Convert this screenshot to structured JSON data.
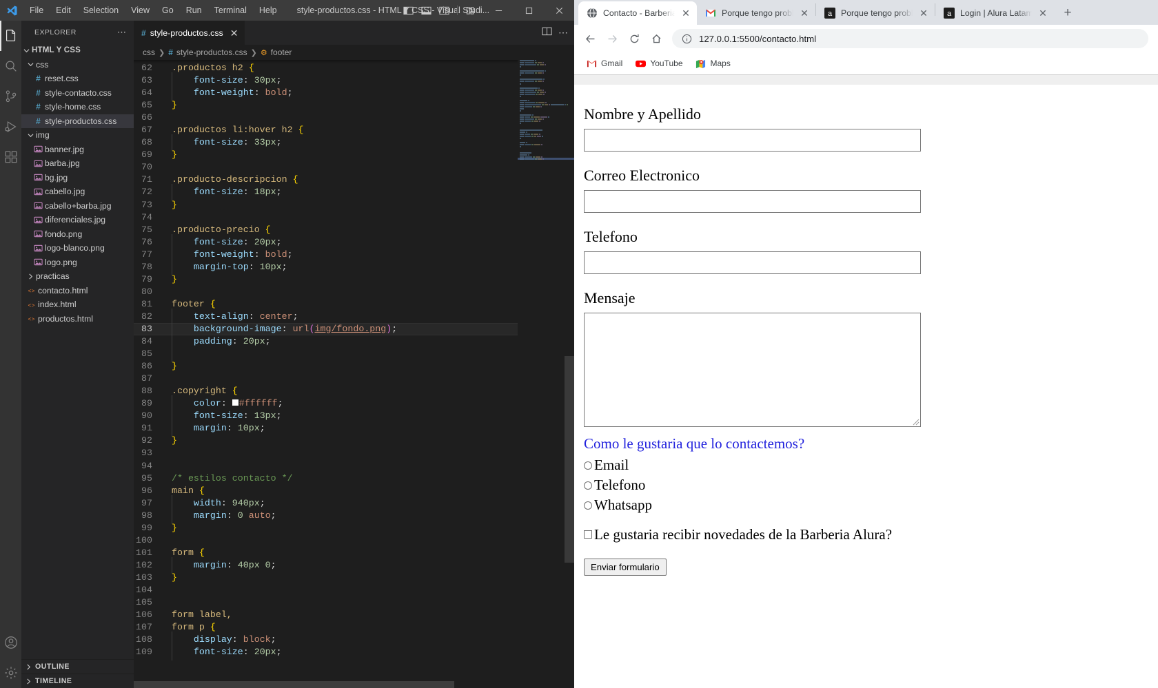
{
  "vscode": {
    "window_title": "style-productos.css - HTML Y CSS - Visual Studi...",
    "menu": [
      "File",
      "Edit",
      "Selection",
      "View",
      "Go",
      "Run",
      "Terminal",
      "Help"
    ],
    "sidebar": {
      "header": "EXPLORER",
      "root": "HTML Y CSS",
      "tree": [
        {
          "label": "css",
          "kind": "folder",
          "depth": 1,
          "expanded": true
        },
        {
          "label": "reset.css",
          "kind": "css",
          "depth": 2
        },
        {
          "label": "style-contacto.css",
          "kind": "css",
          "depth": 2
        },
        {
          "label": "style-home.css",
          "kind": "css",
          "depth": 2
        },
        {
          "label": "style-productos.css",
          "kind": "css",
          "depth": 2,
          "selected": true
        },
        {
          "label": "img",
          "kind": "folder",
          "depth": 1,
          "expanded": true
        },
        {
          "label": "banner.jpg",
          "kind": "image",
          "depth": 2
        },
        {
          "label": "barba.jpg",
          "kind": "image",
          "depth": 2
        },
        {
          "label": "bg.jpg",
          "kind": "image",
          "depth": 2
        },
        {
          "label": "cabello.jpg",
          "kind": "image",
          "depth": 2
        },
        {
          "label": "cabello+barba.jpg",
          "kind": "image",
          "depth": 2
        },
        {
          "label": "diferenciales.jpg",
          "kind": "image",
          "depth": 2
        },
        {
          "label": "fondo.png",
          "kind": "image",
          "depth": 2
        },
        {
          "label": "logo-blanco.png",
          "kind": "image",
          "depth": 2
        },
        {
          "label": "logo.png",
          "kind": "image",
          "depth": 2
        },
        {
          "label": "practicas",
          "kind": "folder",
          "depth": 1,
          "expanded": false
        },
        {
          "label": "contacto.html",
          "kind": "html",
          "depth": 1
        },
        {
          "label": "index.html",
          "kind": "html",
          "depth": 1
        },
        {
          "label": "productos.html",
          "kind": "html",
          "depth": 1
        }
      ],
      "panels": [
        "OUTLINE",
        "TIMELINE"
      ]
    },
    "tab": {
      "label": "style-productos.css"
    },
    "breadcrumb": [
      "css",
      "style-productos.css",
      "footer"
    ],
    "code": {
      "first_line": 62,
      "highlight_line": 83,
      "lines": [
        {
          "n": 62,
          "tokens": [
            {
              "t": ".productos h2 ",
              "c": "sel"
            },
            {
              "t": "{",
              "c": "brace"
            }
          ]
        },
        {
          "n": 63,
          "tokens": [
            {
              "t": "    ",
              "c": "ind"
            },
            {
              "t": "font-size",
              "c": "prop"
            },
            {
              "t": ": ",
              "c": "punc"
            },
            {
              "t": "30px",
              "c": "num"
            },
            {
              "t": ";",
              "c": "punc"
            }
          ]
        },
        {
          "n": 64,
          "tokens": [
            {
              "t": "    ",
              "c": "ind"
            },
            {
              "t": "font-weight",
              "c": "prop"
            },
            {
              "t": ": ",
              "c": "punc"
            },
            {
              "t": "bold",
              "c": "val"
            },
            {
              "t": ";",
              "c": "punc"
            }
          ]
        },
        {
          "n": 65,
          "tokens": [
            {
              "t": "}",
              "c": "brace"
            }
          ]
        },
        {
          "n": 66,
          "tokens": []
        },
        {
          "n": 67,
          "tokens": [
            {
              "t": ".productos li:hover h2 ",
              "c": "sel"
            },
            {
              "t": "{",
              "c": "brace"
            }
          ]
        },
        {
          "n": 68,
          "tokens": [
            {
              "t": "    ",
              "c": "ind"
            },
            {
              "t": "font-size",
              "c": "prop"
            },
            {
              "t": ": ",
              "c": "punc"
            },
            {
              "t": "33px",
              "c": "num"
            },
            {
              "t": ";",
              "c": "punc"
            }
          ]
        },
        {
          "n": 69,
          "tokens": [
            {
              "t": "}",
              "c": "brace"
            }
          ]
        },
        {
          "n": 70,
          "tokens": []
        },
        {
          "n": 71,
          "tokens": [
            {
              "t": ".producto-descripcion ",
              "c": "sel"
            },
            {
              "t": "{",
              "c": "brace"
            }
          ]
        },
        {
          "n": 72,
          "tokens": [
            {
              "t": "    ",
              "c": "ind"
            },
            {
              "t": "font-size",
              "c": "prop"
            },
            {
              "t": ": ",
              "c": "punc"
            },
            {
              "t": "18px",
              "c": "num"
            },
            {
              "t": ";",
              "c": "punc"
            }
          ]
        },
        {
          "n": 73,
          "tokens": [
            {
              "t": "}",
              "c": "brace"
            }
          ]
        },
        {
          "n": 74,
          "tokens": []
        },
        {
          "n": 75,
          "tokens": [
            {
              "t": ".producto-precio ",
              "c": "sel"
            },
            {
              "t": "{",
              "c": "brace"
            }
          ]
        },
        {
          "n": 76,
          "tokens": [
            {
              "t": "    ",
              "c": "ind"
            },
            {
              "t": "font-size",
              "c": "prop"
            },
            {
              "t": ": ",
              "c": "punc"
            },
            {
              "t": "20px",
              "c": "num"
            },
            {
              "t": ";",
              "c": "punc"
            }
          ]
        },
        {
          "n": 77,
          "tokens": [
            {
              "t": "    ",
              "c": "ind"
            },
            {
              "t": "font-weight",
              "c": "prop"
            },
            {
              "t": ": ",
              "c": "punc"
            },
            {
              "t": "bold",
              "c": "val"
            },
            {
              "t": ";",
              "c": "punc"
            }
          ]
        },
        {
          "n": 78,
          "tokens": [
            {
              "t": "    ",
              "c": "ind"
            },
            {
              "t": "margin-top",
              "c": "prop"
            },
            {
              "t": ": ",
              "c": "punc"
            },
            {
              "t": "10px",
              "c": "num"
            },
            {
              "t": ";",
              "c": "punc"
            }
          ]
        },
        {
          "n": 79,
          "tokens": [
            {
              "t": "}",
              "c": "brace"
            }
          ]
        },
        {
          "n": 80,
          "tokens": []
        },
        {
          "n": 81,
          "tokens": [
            {
              "t": "footer ",
              "c": "sel"
            },
            {
              "t": "{",
              "c": "brace"
            }
          ]
        },
        {
          "n": 82,
          "tokens": [
            {
              "t": "    ",
              "c": "ind"
            },
            {
              "t": "text-align",
              "c": "prop"
            },
            {
              "t": ": ",
              "c": "punc"
            },
            {
              "t": "center",
              "c": "val"
            },
            {
              "t": ";",
              "c": "punc"
            }
          ]
        },
        {
          "n": 83,
          "tokens": [
            {
              "t": "    ",
              "c": "ind"
            },
            {
              "t": "background-image",
              "c": "prop"
            },
            {
              "t": ": ",
              "c": "punc"
            },
            {
              "t": "url",
              "c": "val"
            },
            {
              "t": "(",
              "c": "paren"
            },
            {
              "t": "img/fondo.png",
              "c": "link"
            },
            {
              "t": ")",
              "c": "paren"
            },
            {
              "t": ";",
              "c": "punc"
            }
          ]
        },
        {
          "n": 84,
          "tokens": [
            {
              "t": "    ",
              "c": "ind"
            },
            {
              "t": "padding",
              "c": "prop"
            },
            {
              "t": ": ",
              "c": "punc"
            },
            {
              "t": "20px",
              "c": "num"
            },
            {
              "t": ";",
              "c": "punc"
            }
          ]
        },
        {
          "n": 85,
          "tokens": [
            {
              "t": "    ",
              "c": "ind"
            }
          ]
        },
        {
          "n": 86,
          "tokens": [
            {
              "t": "}",
              "c": "brace"
            }
          ]
        },
        {
          "n": 87,
          "tokens": []
        },
        {
          "n": 88,
          "tokens": [
            {
              "t": ".copyright ",
              "c": "sel"
            },
            {
              "t": "{",
              "c": "brace"
            }
          ]
        },
        {
          "n": 89,
          "tokens": [
            {
              "t": "    ",
              "c": "ind"
            },
            {
              "t": "color",
              "c": "prop"
            },
            {
              "t": ": ",
              "c": "punc"
            },
            {
              "t": "SWATCH",
              "c": "swatch"
            },
            {
              "t": "#ffffff",
              "c": "val"
            },
            {
              "t": ";",
              "c": "punc"
            }
          ]
        },
        {
          "n": 90,
          "tokens": [
            {
              "t": "    ",
              "c": "ind"
            },
            {
              "t": "font-size",
              "c": "prop"
            },
            {
              "t": ": ",
              "c": "punc"
            },
            {
              "t": "13px",
              "c": "num"
            },
            {
              "t": ";",
              "c": "punc"
            }
          ]
        },
        {
          "n": 91,
          "tokens": [
            {
              "t": "    ",
              "c": "ind"
            },
            {
              "t": "margin",
              "c": "prop"
            },
            {
              "t": ": ",
              "c": "punc"
            },
            {
              "t": "10px",
              "c": "num"
            },
            {
              "t": ";",
              "c": "punc"
            }
          ]
        },
        {
          "n": 92,
          "tokens": [
            {
              "t": "}",
              "c": "brace"
            }
          ]
        },
        {
          "n": 93,
          "tokens": []
        },
        {
          "n": 94,
          "tokens": []
        },
        {
          "n": 95,
          "tokens": [
            {
              "t": "/* estilos contacto */",
              "c": "cmt"
            }
          ]
        },
        {
          "n": 96,
          "tokens": [
            {
              "t": "main ",
              "c": "sel"
            },
            {
              "t": "{",
              "c": "brace"
            }
          ]
        },
        {
          "n": 97,
          "tokens": [
            {
              "t": "    ",
              "c": "ind"
            },
            {
              "t": "width",
              "c": "prop"
            },
            {
              "t": ": ",
              "c": "punc"
            },
            {
              "t": "940px",
              "c": "num"
            },
            {
              "t": ";",
              "c": "punc"
            }
          ]
        },
        {
          "n": 98,
          "tokens": [
            {
              "t": "    ",
              "c": "ind"
            },
            {
              "t": "margin",
              "c": "prop"
            },
            {
              "t": ": ",
              "c": "punc"
            },
            {
              "t": "0 ",
              "c": "num"
            },
            {
              "t": "auto",
              "c": "val"
            },
            {
              "t": ";",
              "c": "punc"
            }
          ]
        },
        {
          "n": 99,
          "tokens": [
            {
              "t": "}",
              "c": "brace"
            }
          ]
        },
        {
          "n": 100,
          "tokens": []
        },
        {
          "n": 101,
          "tokens": [
            {
              "t": "form ",
              "c": "sel"
            },
            {
              "t": "{",
              "c": "brace"
            }
          ]
        },
        {
          "n": 102,
          "tokens": [
            {
              "t": "    ",
              "c": "ind"
            },
            {
              "t": "margin",
              "c": "prop"
            },
            {
              "t": ": ",
              "c": "punc"
            },
            {
              "t": "40px 0",
              "c": "num"
            },
            {
              "t": ";",
              "c": "punc"
            }
          ]
        },
        {
          "n": 103,
          "tokens": [
            {
              "t": "}",
              "c": "brace"
            }
          ]
        },
        {
          "n": 104,
          "tokens": []
        },
        {
          "n": 105,
          "tokens": []
        },
        {
          "n": 106,
          "tokens": [
            {
              "t": "form label,",
              "c": "sel"
            }
          ]
        },
        {
          "n": 107,
          "tokens": [
            {
              "t": "form p ",
              "c": "sel"
            },
            {
              "t": "{",
              "c": "brace"
            }
          ]
        },
        {
          "n": 108,
          "tokens": [
            {
              "t": "    ",
              "c": "ind"
            },
            {
              "t": "display",
              "c": "prop"
            },
            {
              "t": ": ",
              "c": "punc"
            },
            {
              "t": "block",
              "c": "val"
            },
            {
              "t": ";",
              "c": "punc"
            }
          ]
        },
        {
          "n": 109,
          "tokens": [
            {
              "t": "    ",
              "c": "ind"
            },
            {
              "t": "font-size",
              "c": "prop"
            },
            {
              "t": ": ",
              "c": "punc"
            },
            {
              "t": "20px",
              "c": "num"
            },
            {
              "t": ";",
              "c": "punc"
            }
          ]
        }
      ]
    }
  },
  "chrome": {
    "tabs": [
      {
        "title": "Contacto - Barberia A",
        "favicon": "globe-icon",
        "active": true
      },
      {
        "title": "Porque tengo problen",
        "favicon": "gmail-icon",
        "active": false
      },
      {
        "title": "Porque tengo problen",
        "favicon": "alura-icon",
        "active": false
      },
      {
        "title": "Login | Alura Latam -",
        "favicon": "alura-icon",
        "active": false
      }
    ],
    "new_tab_label": "+",
    "toolbar": {
      "back": "back-icon",
      "forward": "forward-icon",
      "reload": "reload-icon",
      "home": "home-icon",
      "url": "127.0.0.1:5500/contacto.html"
    },
    "bookmarks": [
      {
        "label": "Gmail",
        "icon": "gmail-icon"
      },
      {
        "label": "YouTube",
        "icon": "youtube-icon"
      },
      {
        "label": "Maps",
        "icon": "maps-icon"
      }
    ]
  },
  "page": {
    "fields": [
      {
        "label": "Nombre y Apellido",
        "value": "",
        "type": "text"
      },
      {
        "label": "Correo Electronico",
        "value": "",
        "type": "text"
      },
      {
        "label": "Telefono",
        "value": "",
        "type": "text"
      },
      {
        "label": "Mensaje",
        "value": "",
        "type": "textarea"
      }
    ],
    "contact_question": "Como le gustaria que lo contactemos?",
    "radios": [
      {
        "label": "Email",
        "checked": false
      },
      {
        "label": "Telefono",
        "checked": false
      },
      {
        "label": "Whatsapp",
        "checked": false
      }
    ],
    "newsletter": {
      "label": "Le gustaria recibir novedades de la Barberia Alura?",
      "checked": false
    },
    "submit_label": "Enviar formulario",
    "colors": {
      "question": "#2222dd",
      "border": "#767676"
    }
  }
}
